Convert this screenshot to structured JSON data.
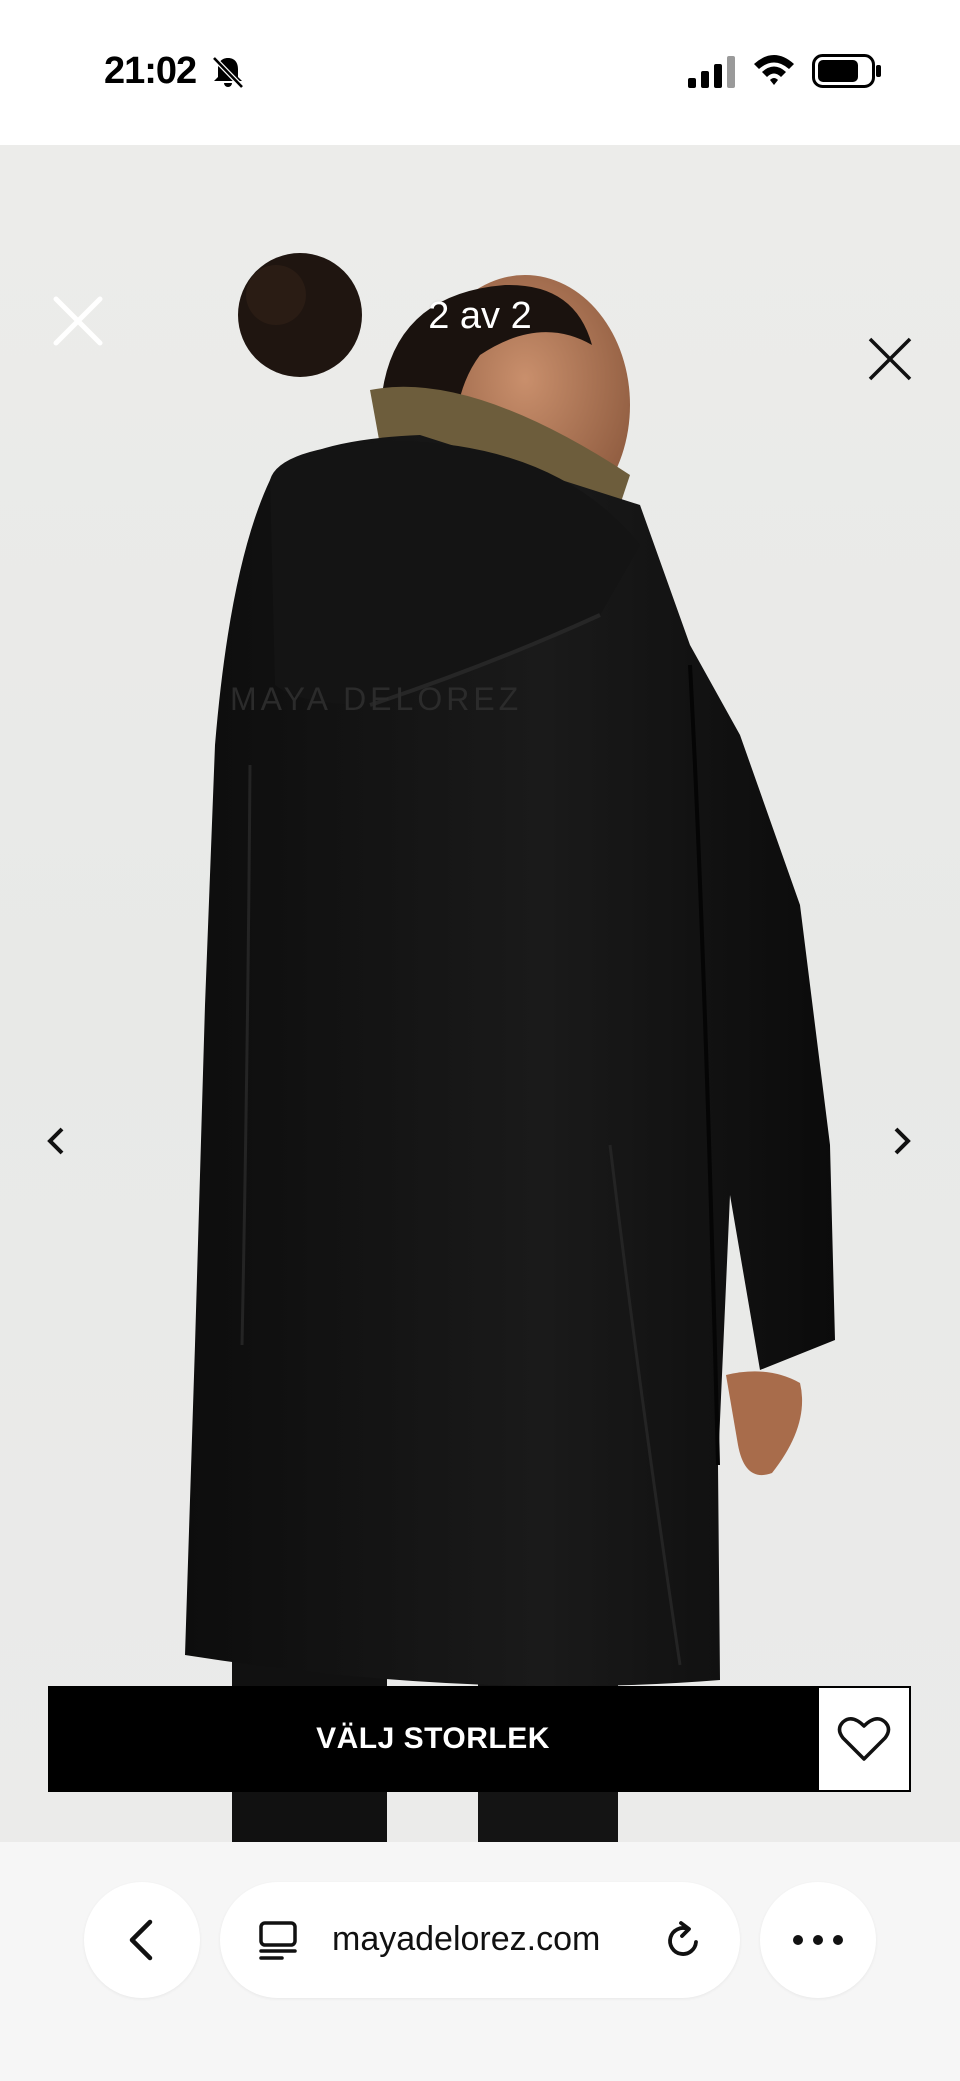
{
  "status_bar": {
    "time": "21:02",
    "icons": [
      "bell-off-icon",
      "cellular-signal-icon",
      "wifi-icon",
      "battery-icon"
    ]
  },
  "lightbox": {
    "counter": "2 av 2",
    "close_icon": "close-icon",
    "prev_icon": "chevron-left-icon",
    "next_icon": "chevron-right-icon"
  },
  "product": {
    "image_text": "MAYA DELOREZ",
    "size_button_label": "VÄLJ STORLEK",
    "wishlist_icon": "heart-icon"
  },
  "browser": {
    "url": "mayadelorez.com",
    "icons": [
      "chevron-left-icon",
      "reader-icon",
      "reload-icon",
      "more-icon"
    ]
  },
  "colors": {
    "button_bg": "#000000",
    "button_text": "#ffffff",
    "browser_bg": "#f6f6f6"
  }
}
